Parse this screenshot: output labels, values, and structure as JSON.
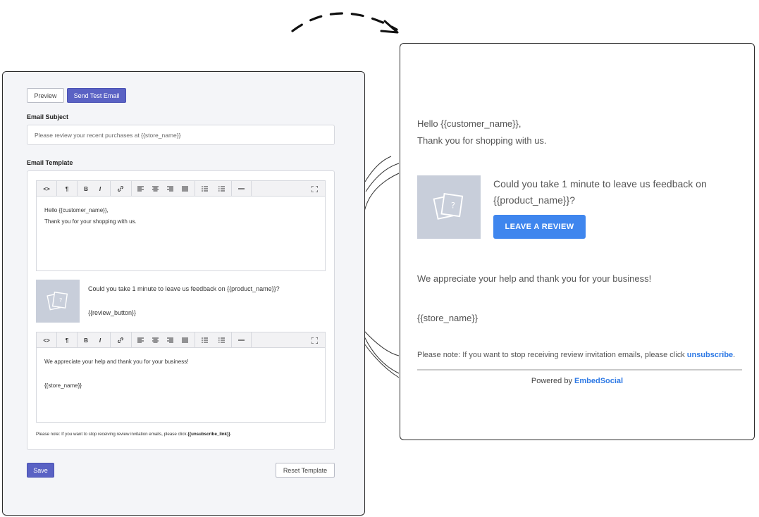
{
  "editor": {
    "preview_label": "Preview",
    "send_test_label": "Send Test Email",
    "subject_label": "Email Subject",
    "subject_value": "Please review your recent purchases at {{store_name}}",
    "template_label": "Email Template",
    "toolbar": {
      "code": "<>",
      "paragraph": "¶",
      "bold": "B",
      "italic": "I",
      "link": "🔗",
      "align_left": "≡",
      "align_center": "≡",
      "align_right": "≡",
      "justify": "≡",
      "bullet_list": "☰",
      "ordered_list": "☰",
      "horizontal_rule": "—",
      "fullscreen": "⛶"
    },
    "top_block": {
      "line1": "Hello {{customer_name}},",
      "line2": "Thank you for your shopping with us."
    },
    "product_question": "Could you take 1 minute to leave us feedback on {{product_name}}?",
    "review_button_placeholder": "{{review_button}}",
    "bottom_block": {
      "line1": "We appreciate your help and thank you for your business!",
      "line2": "{{store_name}}"
    },
    "unsubscribe_note": "Please note: If you want to stop receiving review invitation emails, please click ",
    "unsubscribe_link": "{{unsubscribe_link}}",
    "unsubscribe_end": ".",
    "save_label": "Save",
    "reset_label": "Reset Template"
  },
  "preview": {
    "greeting": "Hello {{customer_name}},",
    "thanks": "Thank you for shopping with us.",
    "question": "Could you take 1 minute to leave us feedback on {{product_name}}?",
    "review_button": "LEAVE A REVIEW",
    "appreciation": "We appreciate your help and thank you for your business!",
    "store": "{{store_name}}",
    "note_text": "Please note: If you want to stop receiving review invitation emails, please click ",
    "note_link": "unsubscribe",
    "note_end": ".",
    "powered_prefix": "Powered by ",
    "powered_brand": "EmbedSocial"
  },
  "colors": {
    "primary_button": "#5a62c4",
    "review_button": "#3f86ee",
    "link": "#2f7ae5",
    "placeholder_image": "#c8ceda"
  }
}
